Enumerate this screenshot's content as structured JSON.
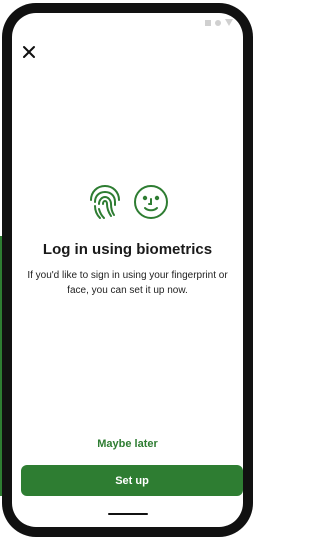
{
  "status": {
    "icons": [
      "square-icon",
      "circle-icon",
      "triangle-icon"
    ]
  },
  "header": {
    "close_icon": "close-icon"
  },
  "content": {
    "icons": [
      "fingerprint-icon",
      "face-icon"
    ],
    "title": "Log in using biometrics",
    "description": "If you'd like to sign in using your fingerprint or face, you can set it up now."
  },
  "actions": {
    "maybe_later_label": "Maybe later",
    "setup_label": "Set up"
  },
  "colors": {
    "accent": "#2e7d32",
    "device": "#111111",
    "background": "#ffffff"
  }
}
